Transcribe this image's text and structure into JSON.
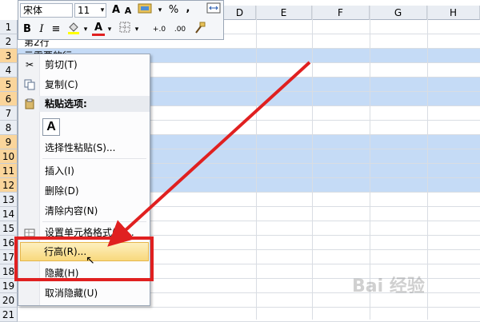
{
  "columns": [
    "D",
    "E",
    "F",
    "G",
    "H"
  ],
  "rows": [
    "1",
    "2",
    "3",
    "4",
    "5",
    "6",
    "7",
    "8",
    "9",
    "10",
    "11",
    "12",
    "13",
    "14",
    "15",
    "16",
    "17",
    "18",
    "19",
    "20",
    "21"
  ],
  "cells": {
    "a2": "第2行",
    "a3": "示需要的行"
  },
  "toolbar": {
    "font_name": "宋体",
    "font_size": "11",
    "grow_font": "A",
    "shrink_font": "A",
    "percent": "%",
    "comma": ",",
    "bold": "B",
    "italic": "I",
    "align": "≡",
    "font_color_letter": "A",
    "inc_decimal": "+.0",
    "dec_decimal": ".00"
  },
  "menu": {
    "cut": "剪切(T)",
    "copy": "复制(C)",
    "paste_options": "粘贴选项:",
    "paste_icon_letter": "A",
    "paste_special": "选择性粘贴(S)...",
    "insert": "插入(I)",
    "delete": "删除(D)",
    "clear": "清除内容(N)",
    "format_cells": "设置单元格格式(F)...",
    "row_height": "行高(R)...",
    "hide": "隐藏(H)",
    "unhide": "取消隐藏(U)"
  },
  "watermark": "Bai 经验",
  "colors": {
    "selection": "#c5dbf6",
    "highlight_border": "#e02020",
    "arrow": "#e02020"
  }
}
